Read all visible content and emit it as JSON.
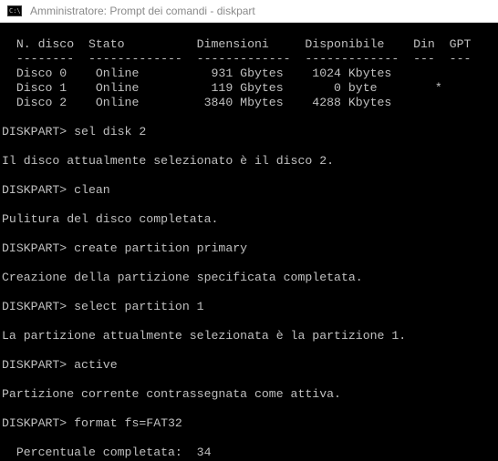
{
  "window": {
    "title": "Amministratore: Prompt dei comandi - diskpart",
    "icon": "cmd-icon",
    "icon_glyph": "C:\\"
  },
  "colors": {
    "console_bg": "#000000",
    "console_text": "#c0c0c0",
    "titlebar_bg": "#ffffff",
    "title_text": "#8a8a8a"
  },
  "console": {
    "header_line": "  N. disco  Stato          Dimensioni     Disponibile    Din  GPT",
    "separator_line": "  --------  -------------  -------------  -------------  ---  ---",
    "disk_rows": [
      "  Disco 0    Online          931 Gbytes    1024 Kbytes",
      "  Disco 1    Online          119 Gbytes       0 byte        *",
      "  Disco 2    Online         3840 Mbytes    4288 Kbytes"
    ],
    "cmd_sel_disk": "DISKPART> sel disk 2",
    "out_sel_disk": "Il disco attualmente selezionato è il disco 2.",
    "cmd_clean": "DISKPART> clean",
    "out_clean": "Pulitura del disco completata.",
    "cmd_create": "DISKPART> create partition primary",
    "out_create": "Creazione della partizione specificata completata.",
    "cmd_select_part": "DISKPART> select partition 1",
    "out_select_part": "La partizione attualmente selezionata è la partizione 1.",
    "cmd_active": "DISKPART> active",
    "out_active": "Partizione corrente contrassegnata come attiva.",
    "cmd_format": "DISKPART> format fs=FAT32",
    "progress_line": "  Percentuale completata:  34"
  }
}
